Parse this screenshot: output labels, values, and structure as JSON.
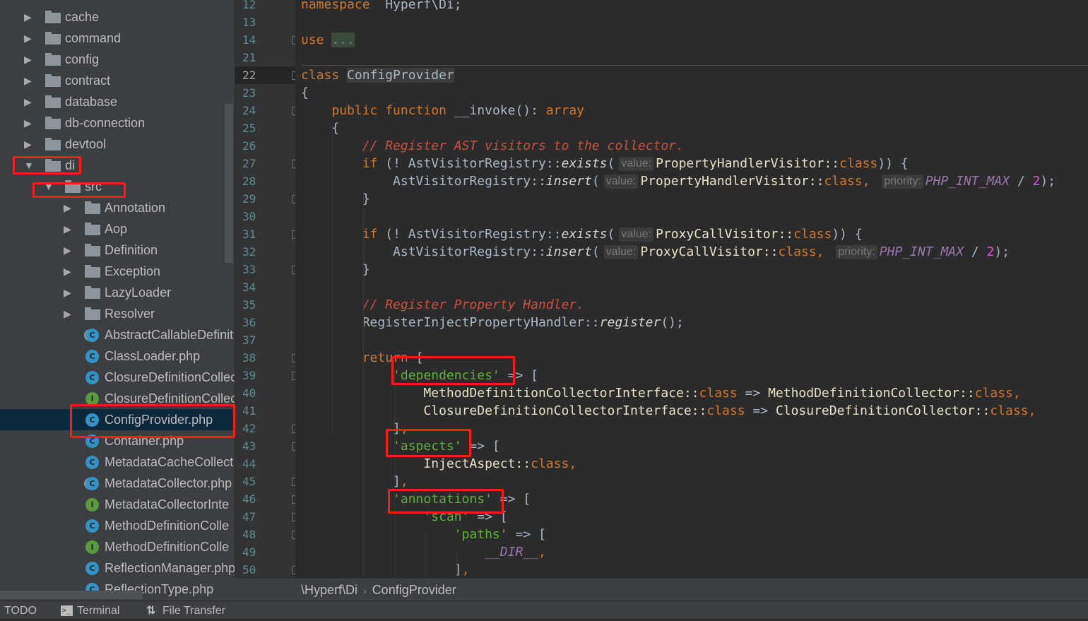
{
  "sidebar": {
    "items": [
      {
        "label": "cache",
        "type": "folder",
        "level": 0,
        "state": "collapsed"
      },
      {
        "label": "command",
        "type": "folder",
        "level": 0,
        "state": "collapsed"
      },
      {
        "label": "config",
        "type": "folder",
        "level": 0,
        "state": "collapsed"
      },
      {
        "label": "contract",
        "type": "folder",
        "level": 0,
        "state": "collapsed"
      },
      {
        "label": "database",
        "type": "folder",
        "level": 0,
        "state": "collapsed"
      },
      {
        "label": "db-connection",
        "type": "folder",
        "level": 0,
        "state": "collapsed"
      },
      {
        "label": "devtool",
        "type": "folder",
        "level": 0,
        "state": "collapsed"
      },
      {
        "label": "di",
        "type": "folder",
        "level": 0,
        "state": "expanded"
      },
      {
        "label": "src",
        "type": "folder",
        "level": 1,
        "state": "expanded"
      },
      {
        "label": "Annotation",
        "type": "folder",
        "level": 2,
        "state": "collapsed"
      },
      {
        "label": "Aop",
        "type": "folder",
        "level": 2,
        "state": "collapsed"
      },
      {
        "label": "Definition",
        "type": "folder",
        "level": 2,
        "state": "collapsed"
      },
      {
        "label": "Exception",
        "type": "folder",
        "level": 2,
        "state": "collapsed"
      },
      {
        "label": "LazyLoader",
        "type": "folder",
        "level": 2,
        "state": "collapsed"
      },
      {
        "label": "Resolver",
        "type": "folder",
        "level": 2,
        "state": "collapsed"
      },
      {
        "label": "AbstractCallableDefinit",
        "type": "abstract-class",
        "level": 2
      },
      {
        "label": "ClassLoader.php",
        "type": "class",
        "level": 2
      },
      {
        "label": "ClosureDefinitionCollec",
        "type": "class",
        "level": 2
      },
      {
        "label": "ClosureDefinitionCollec",
        "type": "interface",
        "level": 2
      },
      {
        "label": "ConfigProvider.php",
        "type": "class",
        "level": 2,
        "selected": true
      },
      {
        "label": "Container.php",
        "type": "class",
        "level": 2
      },
      {
        "label": "MetadataCacheCollect",
        "type": "class",
        "level": 2
      },
      {
        "label": "MetadataCollector.php",
        "type": "abstract-class",
        "level": 2
      },
      {
        "label": "MetadataCollectorInte",
        "type": "interface",
        "level": 2
      },
      {
        "label": "MethodDefinitionColle",
        "type": "class",
        "level": 2
      },
      {
        "label": "MethodDefinitionColle",
        "type": "interface",
        "level": 2
      },
      {
        "label": "ReflectionManager.php",
        "type": "class",
        "level": 2
      },
      {
        "label": "ReflectionType.php",
        "type": "class",
        "level": 2
      }
    ]
  },
  "editor": {
    "lines": [
      {
        "n": "12",
        "t": [
          [
            "kw",
            "namespace"
          ],
          [
            "",
            "  Hyperf\\Di;"
          ]
        ]
      },
      {
        "n": "13",
        "t": []
      },
      {
        "n": "14",
        "fold": "plus",
        "t": [
          [
            "kw",
            "use"
          ],
          [
            "",
            " "
          ],
          [
            "foldbox",
            "..."
          ]
        ]
      },
      {
        "n": "21",
        "t": []
      },
      {
        "n": "22",
        "cur": true,
        "fold": "open",
        "t": [
          [
            "kw",
            "class"
          ],
          [
            "",
            " "
          ],
          [
            "hl",
            "ConfigProvider"
          ]
        ]
      },
      {
        "n": "23",
        "t": [
          [
            "",
            "{"
          ]
        ]
      },
      {
        "n": "24",
        "fold": "open",
        "t": [
          [
            "",
            "    "
          ],
          [
            "kw",
            "public function"
          ],
          [
            "",
            " __invoke(): "
          ],
          [
            "kw",
            "array"
          ]
        ]
      },
      {
        "n": "25",
        "t": [
          [
            "",
            "    {"
          ]
        ]
      },
      {
        "n": "26",
        "t": [
          [
            "",
            "        "
          ],
          [
            "cm",
            "// Register AST visitors to the collector."
          ]
        ]
      },
      {
        "n": "27",
        "fold": "open",
        "t": [
          [
            "",
            "        "
          ],
          [
            "kw",
            "if"
          ],
          [
            "",
            " (! AstVisitorRegistry::"
          ],
          [
            "fn",
            "exists"
          ],
          [
            "",
            "("
          ],
          [
            "hint",
            "value:"
          ],
          [
            "cls",
            "PropertyHandlerVisitor::"
          ],
          [
            "kw",
            "class"
          ],
          [
            "",
            ")) {"
          ]
        ]
      },
      {
        "n": "28",
        "t": [
          [
            "",
            "            AstVisitorRegistry::"
          ],
          [
            "fn",
            "insert"
          ],
          [
            "",
            "("
          ],
          [
            "hint",
            "value:"
          ],
          [
            "cls",
            "PropertyHandlerVisitor::"
          ],
          [
            "kw",
            "class"
          ],
          [
            "kw",
            ", "
          ],
          [
            "hint",
            "priority:"
          ],
          [
            "const",
            "PHP_INT_MAX"
          ],
          [
            "",
            " / "
          ],
          [
            "num",
            "2"
          ],
          [
            "",
            ");"
          ]
        ]
      },
      {
        "n": "29",
        "fold": "close",
        "t": [
          [
            "",
            "        }"
          ]
        ]
      },
      {
        "n": "30",
        "t": []
      },
      {
        "n": "31",
        "fold": "open",
        "t": [
          [
            "",
            "        "
          ],
          [
            "kw",
            "if"
          ],
          [
            "",
            " (! AstVisitorRegistry::"
          ],
          [
            "fn",
            "exists"
          ],
          [
            "",
            "("
          ],
          [
            "hint",
            "value:"
          ],
          [
            "cls",
            "ProxyCallVisitor::"
          ],
          [
            "kw",
            "class"
          ],
          [
            "",
            ")) {"
          ]
        ]
      },
      {
        "n": "32",
        "t": [
          [
            "",
            "            AstVisitorRegistry::"
          ],
          [
            "fn",
            "insert"
          ],
          [
            "",
            "("
          ],
          [
            "hint",
            "value:"
          ],
          [
            "cls",
            "ProxyCallVisitor::"
          ],
          [
            "kw",
            "class"
          ],
          [
            "kw",
            ", "
          ],
          [
            "hint",
            "priority:"
          ],
          [
            "const",
            "PHP_INT_MAX"
          ],
          [
            "",
            " / "
          ],
          [
            "num",
            "2"
          ],
          [
            "",
            ");"
          ]
        ]
      },
      {
        "n": "33",
        "fold": "close",
        "t": [
          [
            "",
            "        }"
          ]
        ]
      },
      {
        "n": "34",
        "t": []
      },
      {
        "n": "35",
        "t": [
          [
            "",
            "        "
          ],
          [
            "cm",
            "// Register Property Handler."
          ]
        ]
      },
      {
        "n": "36",
        "t": [
          [
            "",
            "        RegisterInjectPropertyHandler::"
          ],
          [
            "fn",
            "register"
          ],
          [
            "",
            "();"
          ]
        ]
      },
      {
        "n": "37",
        "t": []
      },
      {
        "n": "38",
        "fold": "open",
        "t": [
          [
            "",
            "        "
          ],
          [
            "kw",
            "return"
          ],
          [
            "",
            " ["
          ]
        ]
      },
      {
        "n": "39",
        "fold": "open",
        "t": [
          [
            "",
            "            "
          ],
          [
            "str",
            "'dependencies'"
          ],
          [
            "",
            " => ["
          ]
        ]
      },
      {
        "n": "40",
        "t": [
          [
            "",
            "                "
          ],
          [
            "cls",
            "MethodDefinitionCollectorInterface::"
          ],
          [
            "kw",
            "class"
          ],
          [
            "",
            " => "
          ],
          [
            "cls",
            "MethodDefinitionCollector::"
          ],
          [
            "kw",
            "class,"
          ]
        ]
      },
      {
        "n": "41",
        "t": [
          [
            "",
            "                "
          ],
          [
            "cls",
            "ClosureDefinitionCollectorInterface::"
          ],
          [
            "kw",
            "class"
          ],
          [
            "",
            " => "
          ],
          [
            "cls",
            "ClosureDefinitionCollector::"
          ],
          [
            "kw",
            "class,"
          ]
        ]
      },
      {
        "n": "42",
        "fold": "close",
        "t": [
          [
            "",
            "            ]"
          ],
          [
            "kw",
            ","
          ]
        ]
      },
      {
        "n": "43",
        "fold": "open",
        "t": [
          [
            "",
            "            "
          ],
          [
            "str",
            "'aspects'"
          ],
          [
            "",
            " => ["
          ]
        ]
      },
      {
        "n": "44",
        "t": [
          [
            "",
            "                "
          ],
          [
            "cls",
            "InjectAspect::"
          ],
          [
            "kw",
            "class,"
          ]
        ]
      },
      {
        "n": "45",
        "fold": "close",
        "t": [
          [
            "",
            "            ]"
          ],
          [
            "kw",
            ","
          ]
        ]
      },
      {
        "n": "46",
        "fold": "open",
        "t": [
          [
            "",
            "            "
          ],
          [
            "str",
            "'annotations'"
          ],
          [
            "",
            " => ["
          ]
        ]
      },
      {
        "n": "47",
        "fold": "open",
        "t": [
          [
            "",
            "                "
          ],
          [
            "str",
            "'scan'"
          ],
          [
            "",
            " => ["
          ]
        ]
      },
      {
        "n": "48",
        "fold": "open",
        "t": [
          [
            "",
            "                    "
          ],
          [
            "str",
            "'paths'"
          ],
          [
            "",
            " => ["
          ]
        ]
      },
      {
        "n": "49",
        "t": [
          [
            "",
            "                        "
          ],
          [
            "const",
            "__DIR__"
          ],
          [
            "kw",
            ","
          ]
        ]
      },
      {
        "n": "50",
        "fold": "close",
        "t": [
          [
            "",
            "                    ]"
          ],
          [
            "kw",
            ","
          ]
        ]
      }
    ]
  },
  "breadcrumb": {
    "namespace": "\\Hyperf\\Di",
    "separator": "›",
    "class": "ConfigProvider"
  },
  "bottombar": {
    "todo": "TODO",
    "terminal": "Terminal",
    "file_transfer": "File Transfer"
  },
  "colors": {
    "keyword": "#cc7832",
    "string": "#5fae3a",
    "comment": "#c8503f",
    "selection": "#0d293e",
    "annotation_box": "#ff1a1a"
  }
}
